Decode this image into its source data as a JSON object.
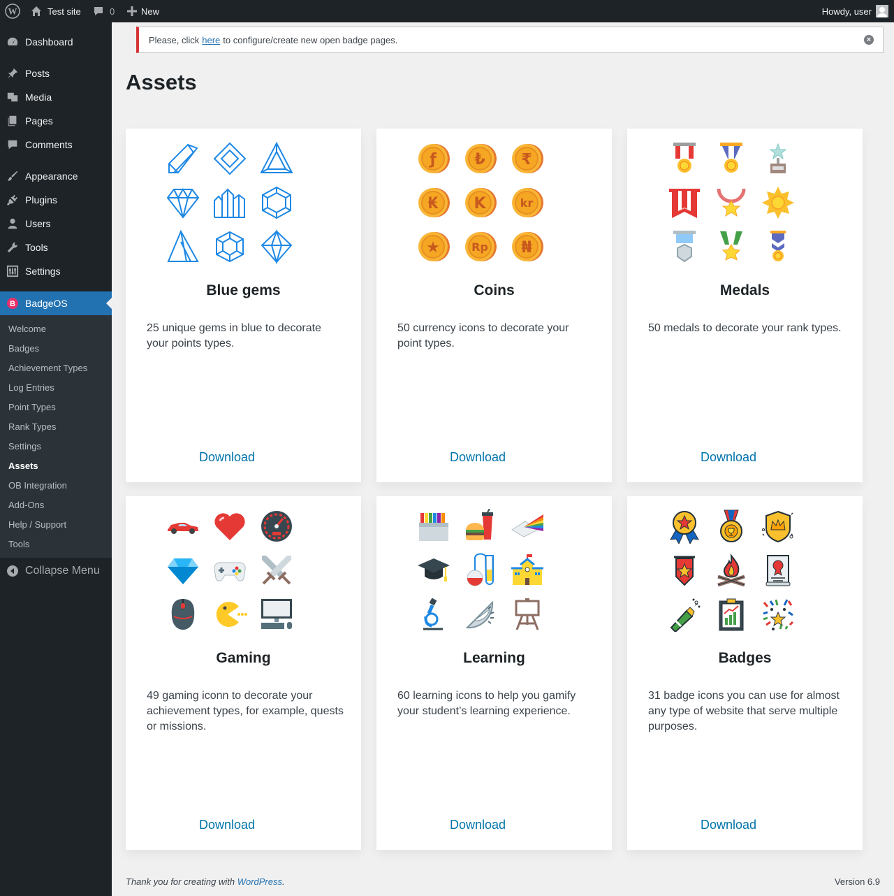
{
  "adminbar": {
    "site_name": "Test site",
    "comments_count": "0",
    "new_label": "New",
    "howdy": "Howdy, user"
  },
  "sidebar": {
    "items": [
      {
        "label": "Dashboard",
        "icon": "dashboard-icon"
      },
      {
        "label": "Posts",
        "icon": "pin-icon"
      },
      {
        "label": "Media",
        "icon": "media-icon"
      },
      {
        "label": "Pages",
        "icon": "pages-icon"
      },
      {
        "label": "Comments",
        "icon": "comments-icon"
      },
      {
        "label": "Appearance",
        "icon": "brush-icon"
      },
      {
        "label": "Plugins",
        "icon": "plugin-icon"
      },
      {
        "label": "Users",
        "icon": "users-icon"
      },
      {
        "label": "Tools",
        "icon": "wrench-icon"
      },
      {
        "label": "Settings",
        "icon": "sliders-icon"
      },
      {
        "label": "BadgeOS",
        "icon": "badgeos-icon"
      }
    ],
    "submenu": [
      "Welcome",
      "Badges",
      "Achievement Types",
      "Log Entries",
      "Point Types",
      "Rank Types",
      "Settings",
      "Assets",
      "OB Integration",
      "Add-Ons",
      "Help / Support",
      "Tools"
    ],
    "active_submenu": "Assets",
    "collapse_label": "Collapse Menu"
  },
  "notice": {
    "before": "Please, click",
    "link": "here",
    "after": "to configure/create new open badge pages."
  },
  "page": {
    "title": "Assets"
  },
  "cards": [
    {
      "title": "Blue gems",
      "description": "25 unique gems in blue to decorate your points types.",
      "download": "Download",
      "icon_set": "blue-gems"
    },
    {
      "title": "Coins",
      "description": "50 currency icons to decorate your point types.",
      "download": "Download",
      "icon_set": "coins"
    },
    {
      "title": "Medals",
      "description": "50 medals to decorate your rank types.",
      "download": "Download",
      "icon_set": "medals"
    },
    {
      "title": "Gaming",
      "description": "49 gaming iconn to decorate your achievement types, for example, quests or missions.",
      "download": "Download",
      "icon_set": "gaming"
    },
    {
      "title": "Learning",
      "description": "60 learning icons to help you gamify your student’s learning experience.",
      "download": "Download",
      "icon_set": "learning"
    },
    {
      "title": "Badges",
      "description": "31 badge icons you can use for almost any type of website that serve multiple purposes.",
      "download": "Download",
      "icon_set": "badges"
    }
  ],
  "coin_symbols": [
    "ƒ",
    "₺",
    "₹",
    "₭",
    "K",
    "kr",
    "★",
    "Rp",
    "₦"
  ],
  "footer": {
    "thanks_before": "Thank you for creating with",
    "thanks_link": "WordPress",
    "thanks_after": ".",
    "version": "Version 6.9"
  },
  "colors": {
    "accent": "#2271b1",
    "adminbar": "#1d2327",
    "notice_error": "#d63638",
    "link": "#0073aa"
  }
}
